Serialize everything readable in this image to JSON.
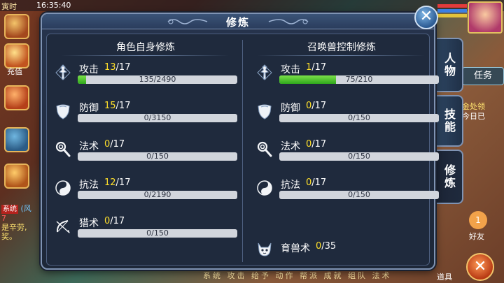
{
  "background": {
    "time_label": "寅时",
    "clock": "16:35:40",
    "recharge_label": "充值",
    "chat_lines": [
      "系统",
      "(风",
      "是辛劳,",
      "奖。"
    ],
    "chat_numbers": "7",
    "right_tabs": [
      "任务"
    ],
    "gold_text": [
      "金处领",
      "今日已"
    ],
    "friend_count": "1",
    "friend_label": "好友",
    "bottom_menu": "系统 攻击 给予 动作 帮派 成就 组队 法术",
    "props_label": "道具",
    "exit_glyph": "✕"
  },
  "dialog": {
    "title": "修炼",
    "close_glyph": "✕"
  },
  "side_tabs": [
    {
      "label": "人物",
      "active": false
    },
    {
      "label": "技能",
      "active": false
    },
    {
      "label": "修炼",
      "active": true
    }
  ],
  "left_column": {
    "heading": "角色自身修炼",
    "rows": [
      {
        "name": "攻击",
        "icon": "attack-icon",
        "level": "13",
        "max": "/17",
        "current": 135,
        "total": 2490,
        "progress_text": "135/2490"
      },
      {
        "name": "防御",
        "icon": "defense-icon",
        "level": "15",
        "max": "/17",
        "current": 0,
        "total": 3150,
        "progress_text": "0/3150"
      },
      {
        "name": "法术",
        "icon": "magic-icon",
        "level": "0",
        "max": "/17",
        "current": 0,
        "total": 150,
        "progress_text": "0/150"
      },
      {
        "name": "抗法",
        "icon": "resist-magic-icon",
        "level": "12",
        "max": "/17",
        "current": 0,
        "total": 2190,
        "progress_text": "0/2190"
      },
      {
        "name": "猎术",
        "icon": "hunting-icon",
        "level": "0",
        "max": "/17",
        "current": 0,
        "total": 150,
        "progress_text": "0/150"
      }
    ]
  },
  "right_column": {
    "heading": "召唤兽控制修炼",
    "rows": [
      {
        "name": "攻击",
        "icon": "attack-icon",
        "level": "1",
        "max": "/17",
        "current": 75,
        "total": 210,
        "progress_text": "75/210"
      },
      {
        "name": "防御",
        "icon": "defense-icon",
        "level": "0",
        "max": "/17",
        "current": 0,
        "total": 150,
        "progress_text": "0/150"
      },
      {
        "name": "法术",
        "icon": "magic-icon",
        "level": "0",
        "max": "/17",
        "current": 0,
        "total": 150,
        "progress_text": "0/150"
      },
      {
        "name": "抗法",
        "icon": "resist-magic-icon",
        "level": "0",
        "max": "/17",
        "current": 0,
        "total": 150,
        "progress_text": "0/150"
      }
    ],
    "pet_training": {
      "name": "育兽术",
      "icon": "pet-training-icon",
      "level": "0",
      "max": "/35"
    }
  },
  "colors": {
    "level_current": "#ffe02a",
    "bar_fill": "#3fbf22",
    "bar_track": "#d1d5dc",
    "panel": "#1f2a3d",
    "border": "#7f93b3"
  }
}
